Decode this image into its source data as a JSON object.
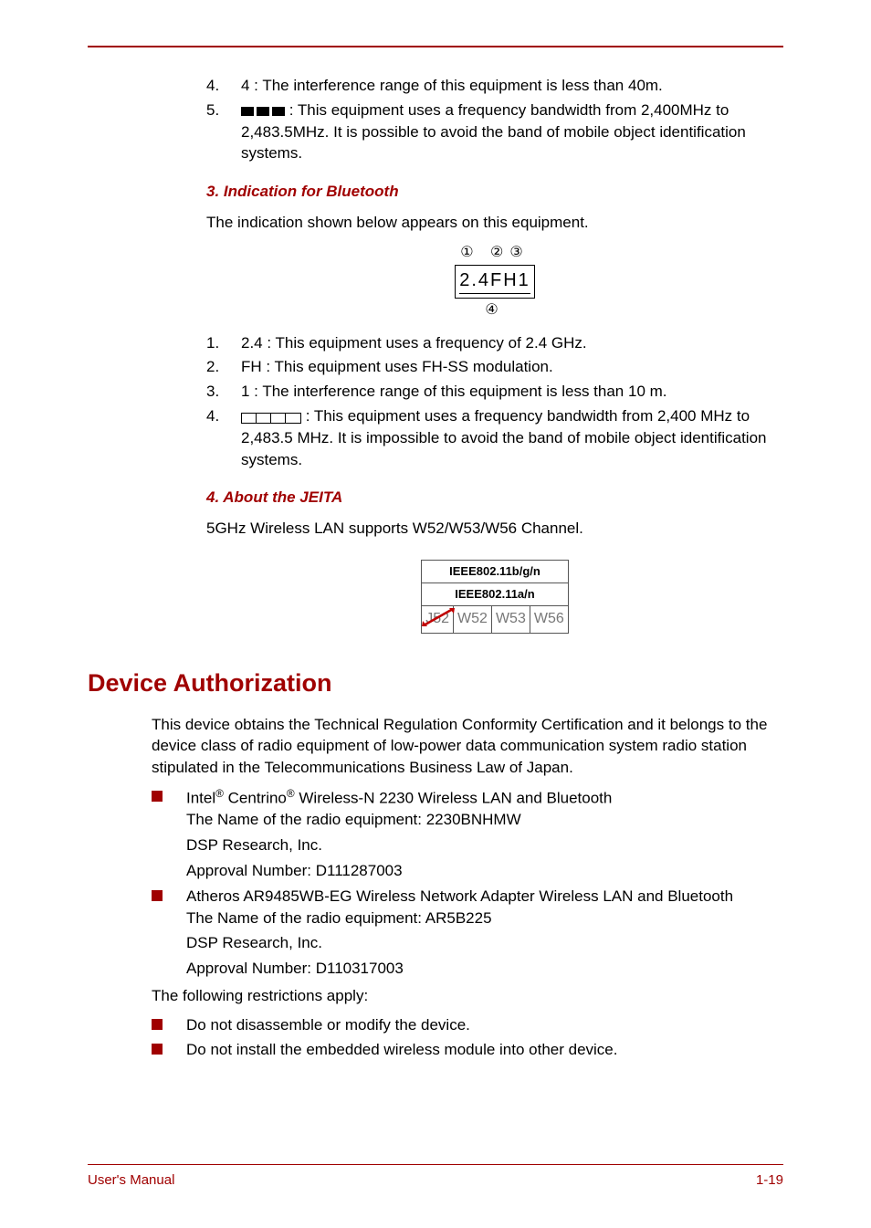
{
  "topList": {
    "item4": {
      "num": "4.",
      "text": "4 : The interference range of this equipment is less than 40m."
    },
    "item5": {
      "num": "5.",
      "text_after": " : This equipment uses a frequency bandwidth from 2,400MHz to 2,483.5MHz. It is possible to avoid the band of mobile object identification systems."
    }
  },
  "sec3": {
    "heading": "3. Indication for Bluetooth",
    "intro": "The indication shown below appears on this equipment.",
    "diagram": {
      "circles": "① ②③",
      "box_text": "2.4FH1",
      "bottom": "④"
    },
    "list": {
      "i1": {
        "num": "1.",
        "text": "2.4 : This equipment uses a frequency of 2.4 GHz."
      },
      "i2": {
        "num": "2.",
        "text": "FH : This equipment uses FH-SS modulation."
      },
      "i3": {
        "num": "3.",
        "text": "1 : The interference range of this equipment is less than 10 m."
      },
      "i4": {
        "num": "4.",
        "text_after": " : This equipment uses a frequency bandwidth from 2,400 MHz to 2,483.5 MHz. It is impossible to avoid the band of mobile object identification systems."
      }
    }
  },
  "sec4": {
    "heading": "4. About the JEITA",
    "intro": "5GHz Wireless LAN supports W52/W53/W56 Channel.",
    "table": {
      "r1": "IEEE802.11b/g/n",
      "r2": "IEEE802.11a/n",
      "cells": [
        "J52",
        "W52",
        "W53",
        "W56"
      ]
    }
  },
  "devauth": {
    "heading": "Device Authorization",
    "para1": "This device obtains the Technical Regulation Conformity Certification and it belongs to the device class of radio equipment of low-power data communication system radio station stipulated in the Telecommunications Business Law of Japan.",
    "b1": {
      "line1_pre": "Intel",
      "line1_mid": " Centrino",
      "line1_post": " Wireless-N 2230 Wireless LAN and Bluetooth",
      "line2": "The Name of the radio equipment: 2230BNHMW",
      "line3": "DSP Research, Inc.",
      "line4": "Approval Number: D111287003"
    },
    "b2": {
      "line1": "Atheros AR9485WB-EG Wireless Network Adapter Wireless LAN and Bluetooth",
      "line2": "The Name of the radio equipment: AR5B225",
      "line3": "DSP Research, Inc.",
      "line4": "Approval Number: D110317003"
    },
    "restrict_intro": "The following restrictions apply:",
    "r1": "Do not disassemble or modify the device.",
    "r2": "Do not install the embedded wireless module into other device."
  },
  "footer": {
    "left": "User's Manual",
    "right": "1-19"
  }
}
